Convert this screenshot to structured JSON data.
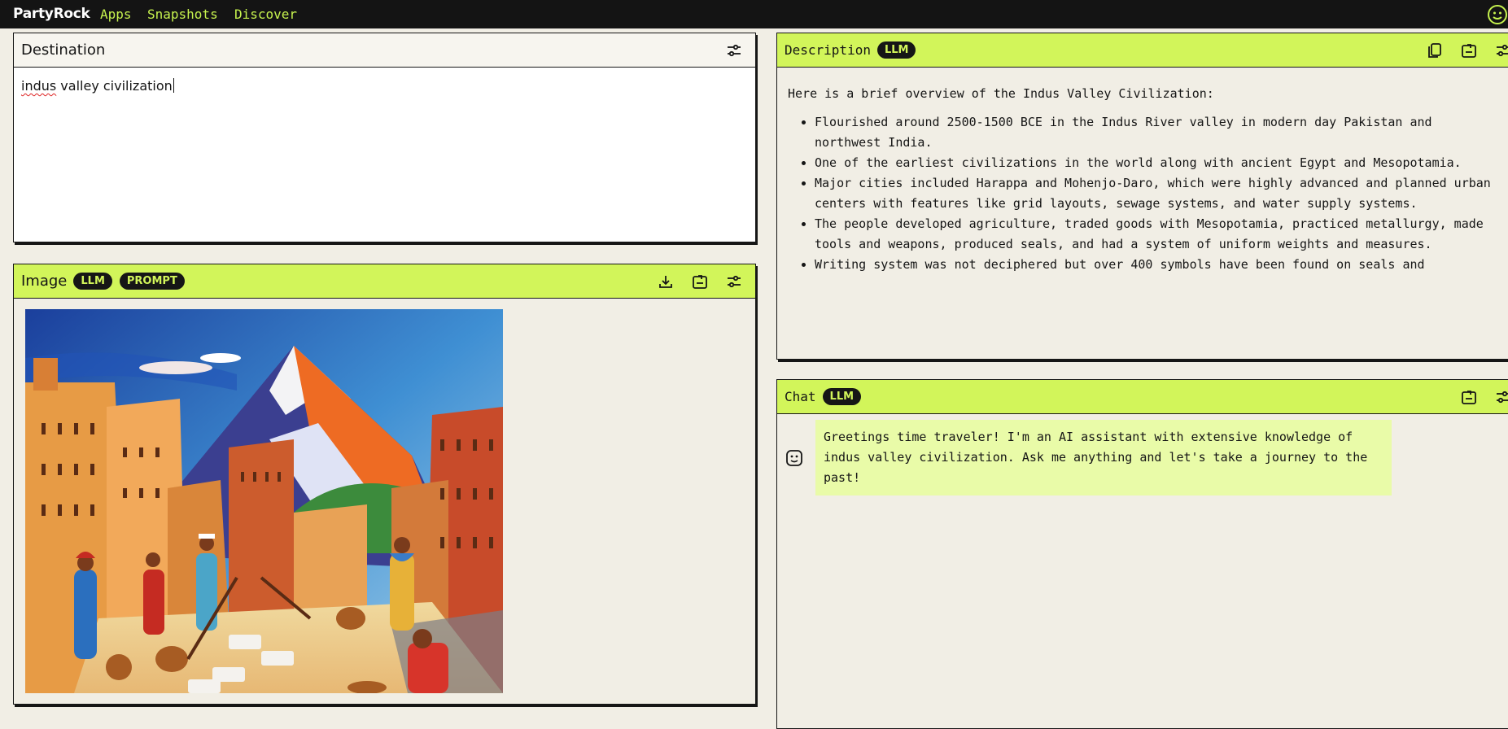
{
  "nav": {
    "brand": "PartyRock",
    "links": [
      "Apps",
      "Snapshots",
      "Discover"
    ]
  },
  "destination": {
    "title": "Destination",
    "value_word1": "indus",
    "value_rest": " valley civilization"
  },
  "image_panel": {
    "title": "Image",
    "badges": [
      "LLM",
      "PROMPT"
    ],
    "scene_icon": "generated-illustration-indus-city"
  },
  "description": {
    "title": "Description",
    "badge": "LLM",
    "intro": "Here is a brief overview of the Indus Valley Civilization:",
    "bullets": [
      "Flourished around 2500-1500 BCE in the Indus River valley in modern day Pakistan and northwest India.",
      "One of the earliest civilizations in the world along with ancient Egypt and Mesopotamia.",
      "Major cities included Harappa and Mohenjo-Daro, which were highly advanced and planned urban centers with features like grid layouts, sewage systems, and water supply systems.",
      "The people developed agriculture, traded goods with Mesopotamia, practiced metallurgy, made tools and weapons, produced seals, and had a system of uniform weights and measures.",
      "Writing system was not deciphered but over 400 symbols have been found on seals and"
    ]
  },
  "chat": {
    "title": "Chat",
    "badge": "LLM",
    "message": "Greetings time traveler! I'm an AI assistant with extensive knowledge of indus valley civilization. Ask me anything and let's take a journey to the past!"
  },
  "colors": {
    "lime": "#d2f55a",
    "nav_text": "#c6f24e",
    "topbar": "#141414",
    "background": "#f1eee5",
    "chat_bubble": "#e9fba8"
  }
}
